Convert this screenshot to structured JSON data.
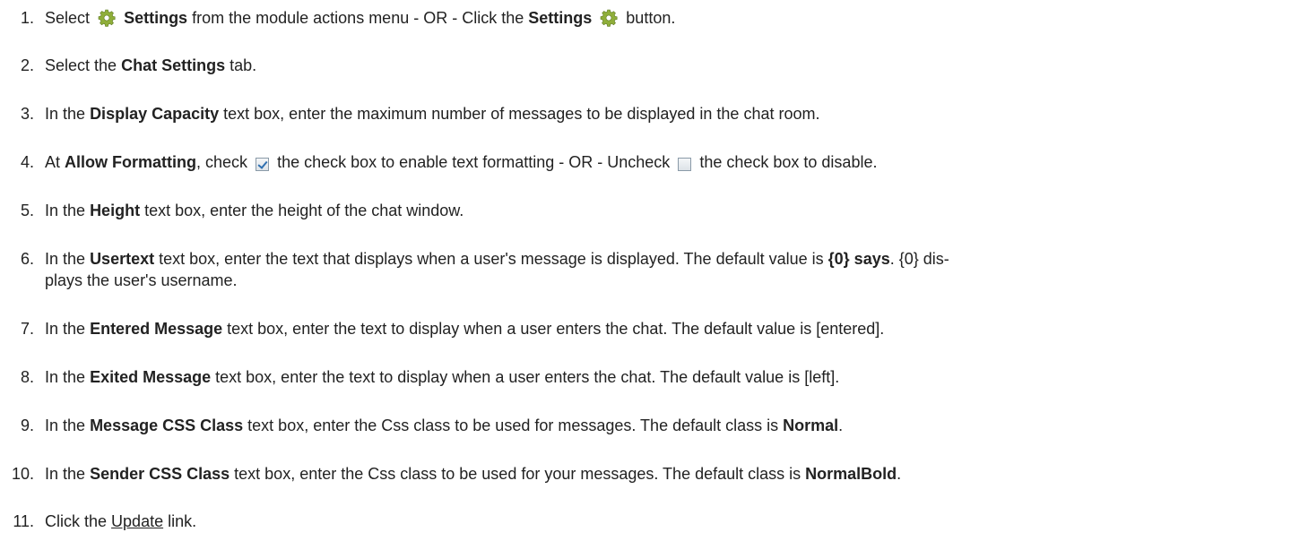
{
  "steps": [
    {
      "num": "1.",
      "a": "Select",
      "b": "Settings",
      "c": "from the module actions menu - OR - Click the",
      "d": "Settings",
      "e": "button."
    },
    {
      "num": "2.",
      "a": "Select the",
      "b": "Chat Settings",
      "c": "tab."
    },
    {
      "num": "3.",
      "a": "In the",
      "b": "Display Capacity",
      "c": "text box, enter the maximum number of messages to be displayed in the chat room."
    },
    {
      "num": "4.",
      "a": "At",
      "b": "Allow Formatting",
      "c": ", check",
      "d": "the check box to enable text formatting - OR - Uncheck",
      "e": "the check box to disable."
    },
    {
      "num": "5.",
      "a": "In the",
      "b": "Height",
      "c": "text box, enter the height of the chat window."
    },
    {
      "num": "6.",
      "a": "In the",
      "b": "Usertext",
      "c": "text box, enter the text that displays when a user's message is displayed. The default value is",
      "d": "{0} says",
      "e": ". {0} dis-",
      "f": "plays the user's username."
    },
    {
      "num": "7.",
      "a": "In the",
      "b": "Entered Message",
      "c": "text box, enter the text to display when a user enters the chat. The default value is [entered]."
    },
    {
      "num": "8.",
      "a": "In the",
      "b": "Exited Message",
      "c": "text box, enter the text to display when a user enters the chat. The default value is [left]."
    },
    {
      "num": "9.",
      "a": "In the",
      "b": "Message CSS Class",
      "c": "text box, enter the Css class to be used for messages. The default class is",
      "d": "Normal",
      "e": "."
    },
    {
      "num": "10.",
      "a": "In the",
      "b": "Sender CSS Class",
      "c": "text box, enter the Css class to be used for your messages. The default class is",
      "d": "NormalBold",
      "e": "."
    },
    {
      "num": "11.",
      "a": "Click the",
      "b": "Update",
      "c": "link."
    }
  ],
  "icons": {
    "settings": "gear-icon",
    "checked": "checkbox-checked-icon",
    "unchecked": "checkbox-unchecked-icon"
  },
  "colors": {
    "text": "#222222",
    "gear": "#8fae3a",
    "checkmark": "#2e6fb0"
  }
}
